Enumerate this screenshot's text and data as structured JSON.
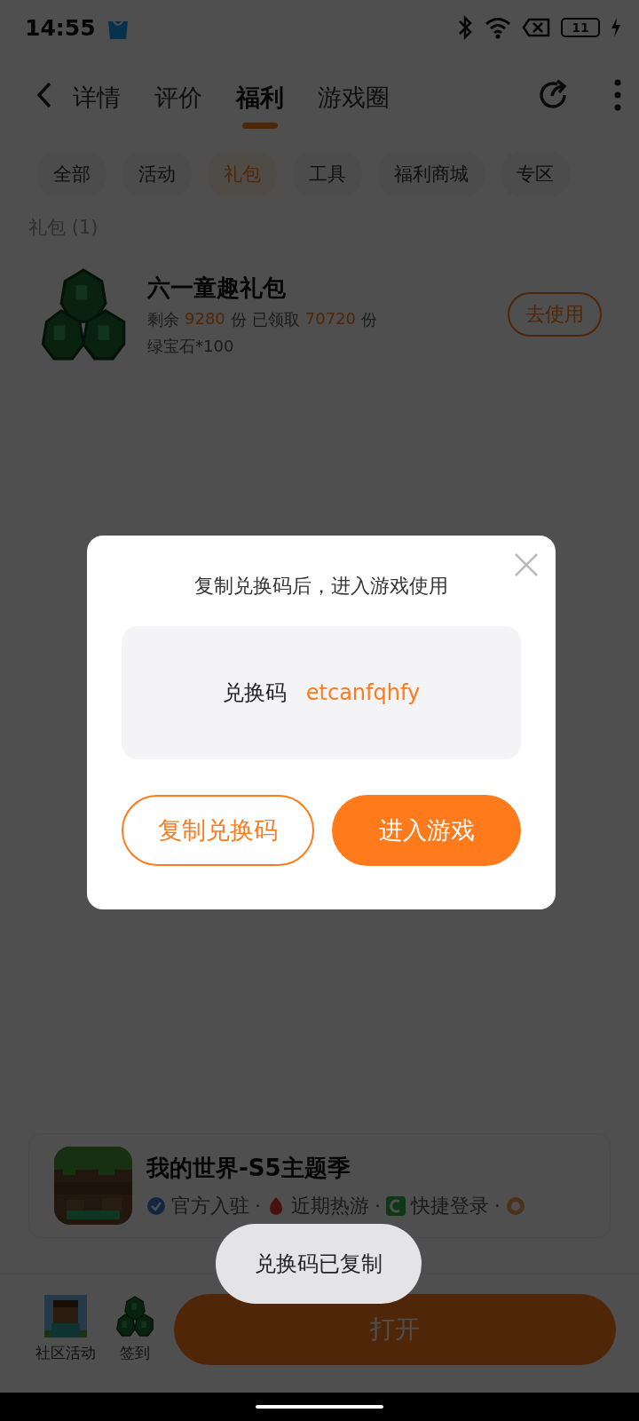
{
  "status_bar": {
    "time": "14:55",
    "battery": "11"
  },
  "nav": {
    "tabs": [
      {
        "label": "详情",
        "selected": false
      },
      {
        "label": "评价",
        "selected": false
      },
      {
        "label": "福利",
        "selected": true
      },
      {
        "label": "游戏圈",
        "selected": false
      }
    ]
  },
  "chips": [
    {
      "label": "全部",
      "selected": false
    },
    {
      "label": "活动",
      "selected": false
    },
    {
      "label": "礼包",
      "selected": true
    },
    {
      "label": "工具",
      "selected": false
    },
    {
      "label": "福利商城",
      "selected": false
    },
    {
      "label": "专区",
      "selected": false
    }
  ],
  "section_title": "礼包 (1)",
  "gift": {
    "title": "六一童趣礼包",
    "stats": [
      {
        "kind": "label",
        "text": "剩余"
      },
      {
        "kind": "number",
        "text": "9280"
      },
      {
        "kind": "label",
        "text": "份"
      },
      {
        "kind": "label",
        "text": "已领取"
      },
      {
        "kind": "number",
        "text": "70720"
      },
      {
        "kind": "label",
        "text": "份"
      }
    ],
    "reward": "绿宝石*100",
    "button": "去使用"
  },
  "game": {
    "title": "我的世界-S5主题季",
    "tags": [
      {
        "kind": "verified",
        "text": "官方入驻",
        "sep": "·"
      },
      {
        "kind": "hot",
        "text": "近期热游",
        "sep": "·"
      },
      {
        "kind": "login",
        "text": "快捷登录",
        "sep": "·"
      },
      {
        "kind": "badge"
      }
    ]
  },
  "bottom_bar": {
    "shortcuts": [
      {
        "kind": "picture",
        "label": "社区活动"
      },
      {
        "kind": "gem",
        "label": "签到"
      }
    ],
    "open_button": "打开"
  },
  "dialog": {
    "message": "复制兑换码后，进入游戏使用",
    "code_label": "兑换码",
    "code": "etcanfqhfy",
    "buttons": [
      {
        "kind": "outline",
        "label": "复制兑换码"
      },
      {
        "kind": "filled",
        "label": "进入游戏"
      }
    ]
  },
  "toast": "兑换码已复制"
}
